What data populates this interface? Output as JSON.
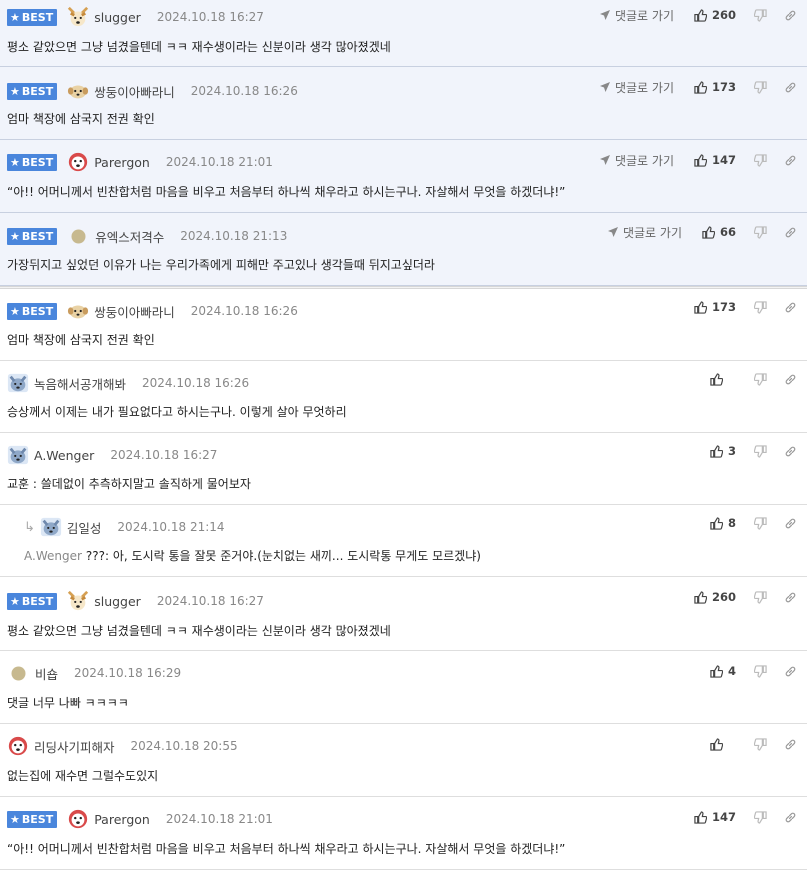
{
  "best_label": "BEST",
  "goto_label": "댓글로 가기",
  "comments": [
    {
      "nick": "slugger",
      "date": "2024.10.18 16:27",
      "text": "평소 같았으면 그냥 넘겼을텐데 ㅋㅋ 재수생이라는 신분이라 생각 많아졌겠네",
      "likes": "260",
      "avatar": "dog-face-avatar"
    },
    {
      "nick": "쌍둥이아빠라니",
      "date": "2024.10.18 16:26",
      "text": "엄마 책장에 삼국지 전권 확인",
      "likes": "173",
      "avatar": "puppy-avatar"
    },
    {
      "nick": "Parergon",
      "date": "2024.10.18 21:01",
      "text": "“아!! 어머니께서 빈찬합처럼 마음을 비우고 처음부터 하나씩 채우라고 하시는구나. 자살해서 무엇을 하겠더냐!”",
      "likes": "147",
      "avatar": "dog-red-avatar"
    },
    {
      "nick": "유엑스저격수",
      "date": "2024.10.18 21:13",
      "text": "가장뒤지고 싶었던 이유가 나는 우리가족에게 피해만 주고있나 생각들때 뒤지고싶더라",
      "likes": "66",
      "avatar": "dot-avatar"
    },
    {
      "nick": "쌍둥이아빠라니",
      "date": "2024.10.18 16:26",
      "text": "엄마 책장에 삼국지 전권 확인",
      "likes": "173",
      "avatar": "puppy-avatar"
    },
    {
      "nick": "녹음해서공개해봐",
      "date": "2024.10.18 16:26",
      "text": "승상께서 이제는 내가 필요없다고 하시는구나. 이렇게 살아 무엇하리",
      "likes": "",
      "avatar": "shiba-avatar"
    },
    {
      "nick": "A.Wenger",
      "date": "2024.10.18 16:27",
      "text": "교훈 : 쓸데없이 추측하지말고 솔직하게 물어보자",
      "likes": "3",
      "avatar": "shiba-avatar"
    },
    {
      "nick": "김일성",
      "date": "2024.10.18 21:14",
      "reply_to": "A.Wenger",
      "text": "???: 아, 도시락 통을 잘못 준거야.(눈치없는 새끼... 도시락통 무게도 모르겠냐)",
      "likes": "8",
      "avatar": "shiba-avatar"
    },
    {
      "nick": "slugger",
      "date": "2024.10.18 16:27",
      "text": "평소 같았으면 그냥 넘겼을텐데 ㅋㅋ 재수생이라는 신분이라 생각 많아졌겠네",
      "likes": "260",
      "avatar": "dog-face-avatar"
    },
    {
      "nick": "비숍",
      "date": "2024.10.18 16:29",
      "text": "댓글 너무 나빠 ㅋㅋㅋㅋ",
      "likes": "4",
      "avatar": "dot-avatar"
    },
    {
      "nick": "리딩사기피해자",
      "date": "2024.10.18 20:55",
      "text": "없는집에 재수면 그럴수도있지",
      "likes": "",
      "avatar": "dog-red-avatar"
    },
    {
      "nick": "Parergon",
      "date": "2024.10.18 21:01",
      "text": "“아!! 어머니께서 빈찬합처럼 마음을 비우고 처음부터 하나씩 채우라고 하시는구나. 자살해서 무엇을 하겠더냐!”",
      "likes": "147",
      "avatar": "dog-red-avatar"
    }
  ]
}
